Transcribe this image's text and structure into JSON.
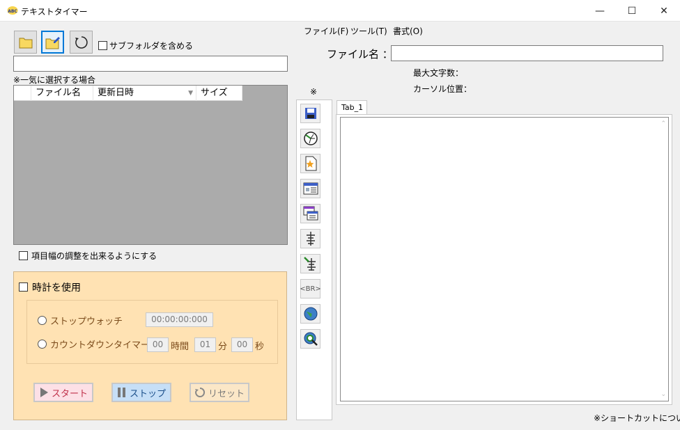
{
  "window": {
    "title": "テキストタイマー",
    "app_icon_text": "ABC"
  },
  "window_controls": {
    "minimize": "—",
    "maximize": "☐",
    "close": "✕"
  },
  "left": {
    "subfolder_label": "サブフォルダを含める",
    "path_value": "",
    "bulk_select_note": "※一気に選択する場合",
    "file_list": {
      "columns": [
        "ファイル名",
        "更新日時",
        "サイズ"
      ],
      "sort_column": "更新日時",
      "rows": []
    },
    "column_resize_label": "項目幅の調整を出来るようにする"
  },
  "clock": {
    "use_clock_label": "時計を使用",
    "stopwatch_label": "ストップウォッチ",
    "stopwatch_value": "00:00:00:000",
    "countdown_label": "カウントダウンタイマー",
    "hours_value": "00",
    "hours_unit": "時間",
    "minutes_value": "01",
    "minutes_unit": "分",
    "seconds_value": "00",
    "seconds_unit": "秒",
    "start_label": "スタート",
    "stop_label": "ストップ",
    "reset_label": "リセット"
  },
  "menu": [
    {
      "label": "ファイル(F)"
    },
    {
      "label": "ツール(T)"
    },
    {
      "label": "書式(O)"
    }
  ],
  "editor": {
    "filename_label": "ファイル名 ：",
    "filename_value": "",
    "max_chars_label": "最大文字数：",
    "cursor_pos_label": "カーソル位置：",
    "asterisk": "※",
    "tab_label": "Tab_1",
    "text": "",
    "shortcut_note": "※ショートカットについて"
  },
  "toolbar_icons": [
    "save-icon",
    "timer-icon",
    "new-file-icon",
    "window-icon",
    "windows-icon",
    "insert-icon",
    "edit-insert-icon",
    "br-tag-icon",
    "globe-icon",
    "search-globe-icon"
  ],
  "br_label": "<BR>",
  "colors": {
    "accent": "#0078d7",
    "clock_panel": "#ffe2b3",
    "list_bg": "#ababab"
  }
}
